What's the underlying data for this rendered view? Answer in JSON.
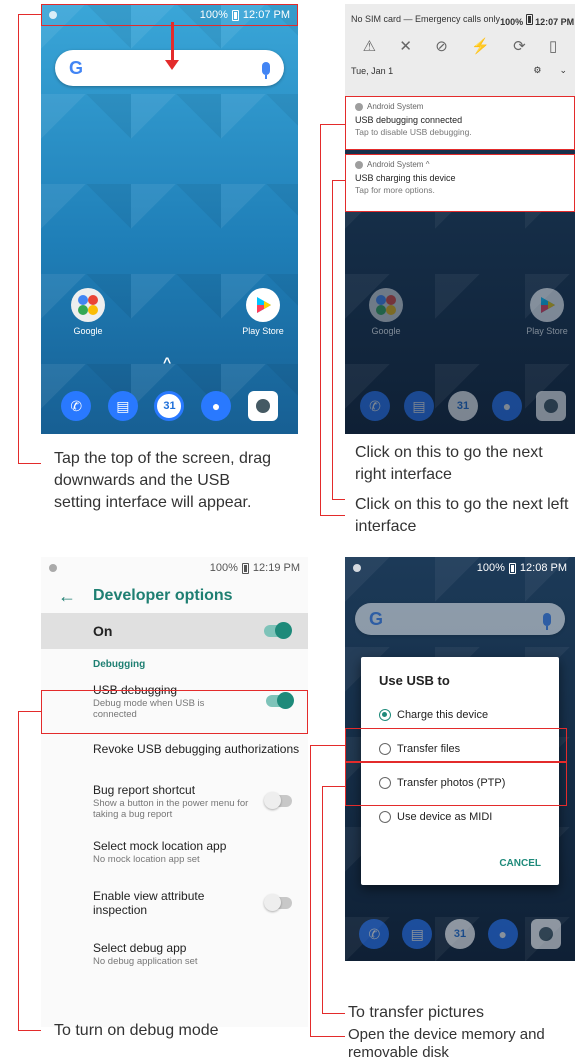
{
  "home": {
    "status": {
      "battery": "100%",
      "time": "12:07 PM"
    },
    "search_letter": "G",
    "apps": [
      {
        "label": "Google"
      },
      {
        "label": "Play Store"
      }
    ],
    "up_chevron": "^",
    "dock_date": "31"
  },
  "shade": {
    "status_text": "No SIM card — Emergency calls only",
    "battery": "100%",
    "time": "12:07 PM",
    "date": "Tue, Jan 1",
    "notifications": [
      {
        "app": "Android System",
        "title": "USB debugging connected",
        "sub": "Tap to disable USB debugging."
      },
      {
        "app": "Android System ^",
        "title": "USB charging this device",
        "sub": "Tap for more options."
      }
    ],
    "apps": [
      {
        "label": "Google"
      },
      {
        "label": "Play Store"
      }
    ],
    "dock_date": "31"
  },
  "developer": {
    "battery": "100%",
    "time": "12:19 PM",
    "title": "Developer options",
    "on_label": "On",
    "section": "Debugging",
    "rows": [
      {
        "title": "USB debugging",
        "sub": "Debug mode when USB is connected"
      },
      {
        "title": "Revoke USB debugging authorizations",
        "sub": ""
      },
      {
        "title": "Bug report shortcut",
        "sub": "Show a button in the power menu for taking a bug report"
      },
      {
        "title": "Select mock location app",
        "sub": "No mock location app set"
      },
      {
        "title": "Enable view attribute inspection",
        "sub": ""
      },
      {
        "title": "Select debug app",
        "sub": "No debug application set"
      }
    ]
  },
  "usb": {
    "battery": "100%",
    "time": "12:08 PM",
    "title": "Use USB to",
    "options": [
      "Charge this device",
      "Transfer files",
      "Transfer photos (PTP)",
      "Use device as MIDI"
    ],
    "selected": 0,
    "cancel": "CANCEL",
    "dock_date": "31"
  },
  "callouts": {
    "tap_top": "Tap the top of the screen, drag downwards and the USB setting interface will appear.",
    "next_right": "Click on this to go the next right interface",
    "next_left": "Click on this to go the next left interface",
    "debug_mode": "To turn on debug mode",
    "transfer_pictures": "To transfer pictures",
    "open_memory": "Open the device memory and removable disk"
  },
  "colors": {
    "accent": "#1e8a7a",
    "callout_red": "#e32b2b"
  }
}
